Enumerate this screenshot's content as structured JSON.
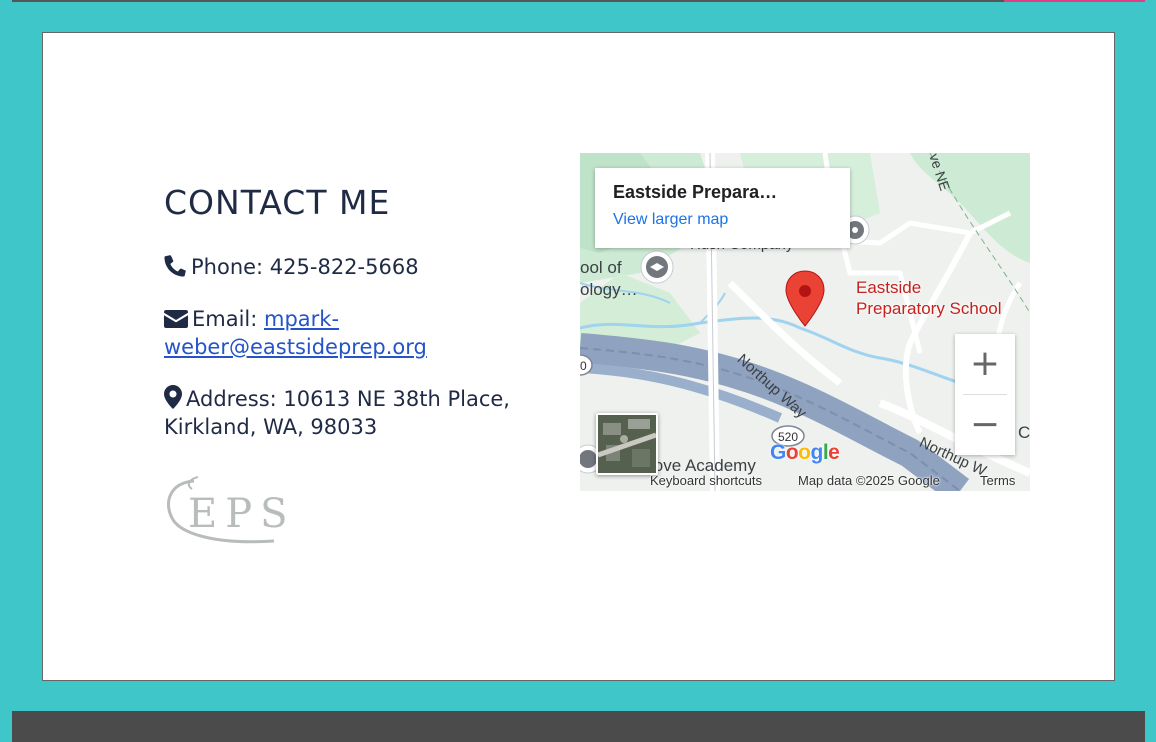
{
  "contact": {
    "heading": "CONTACT ME",
    "phone": "Phone: 425-822-5668",
    "email_label": "Email: ",
    "email_link": "mpark-weber@eastsideprep.org",
    "address": "Address: 10613 NE 38th Place, Kirkland, WA, 98033",
    "logo_text": "EPS"
  },
  "map": {
    "place_name": "Eastside Prepara…",
    "larger_map": "View larger map",
    "marker_label_line1": "Eastside",
    "marker_label_line2": "Preparatory School",
    "zoom_in": "+",
    "zoom_out": "−",
    "keyboard_shortcuts": "Keyboard shortcuts",
    "map_data": "Map data ©2025 Google",
    "terms": "Terms",
    "road_northup": "Northup Way",
    "road_northup_2": "Northup W",
    "route_520": "520",
    "route_520_left": "0",
    "label_school_of": "ool of",
    "label_ology": "ology…",
    "label_company": "Hush Company",
    "label_academy": "love Academy",
    "label_ave_ne": "ve NE",
    "label_c": "C",
    "google": "Google"
  },
  "colors": {
    "page_bg": "#3fc6c8",
    "accent": "#e0407f",
    "text": "#1f2a44",
    "link": "#2454c8",
    "footer": "#4b4b4b"
  }
}
